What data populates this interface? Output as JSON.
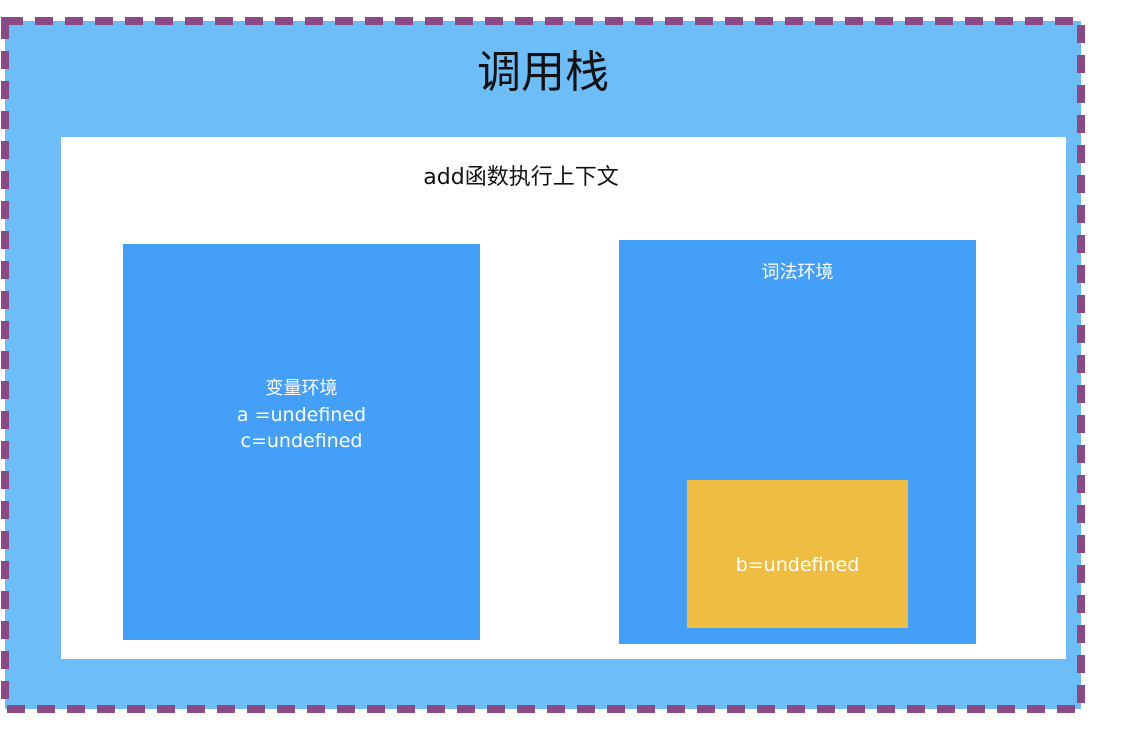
{
  "call_stack": {
    "title": "调用栈"
  },
  "execution_context": {
    "title": "add函数执行上下文",
    "variable_environment": {
      "lines": [
        "变量环境",
        "a =undefined",
        "c=undefined"
      ]
    },
    "lexical_environment": {
      "title": "词法环境",
      "block": {
        "text": "b=undefined"
      }
    }
  },
  "colors": {
    "call_stack_bg": "#6dbdf8",
    "border_dash": "#8b4a86",
    "env_blue": "#449ff8",
    "block_yellow": "#efbd42",
    "context_bg": "#ffffff"
  }
}
